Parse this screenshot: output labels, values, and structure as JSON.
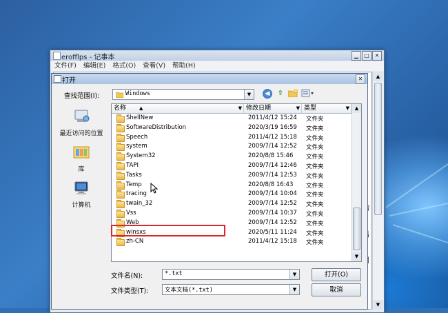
{
  "notepad": {
    "title": "erofflps - 记事本",
    "menu": [
      "文件(F)",
      "编辑(E)",
      "格式(O)",
      "查看(V)",
      "帮助(H)"
    ],
    "side_chars": [
      "物",
      "出",
      "用"
    ]
  },
  "dialog": {
    "title": "打开",
    "look_in_label": "查找范围(I):",
    "look_in_value": "Windows",
    "places": [
      {
        "label": "最近访问的位置",
        "icon": "recent-places-icon"
      },
      {
        "label": "库",
        "icon": "libraries-icon"
      },
      {
        "label": "计算机",
        "icon": "computer-icon"
      }
    ],
    "columns": {
      "name": "名称",
      "date": "修改日期",
      "type": "类型"
    },
    "rows": [
      {
        "name": "ShellNew",
        "date": "2011/4/12 15:24",
        "type": "文件夹"
      },
      {
        "name": "SoftwareDistribution",
        "date": "2020/3/19 16:59",
        "type": "文件夹"
      },
      {
        "name": "Speech",
        "date": "2011/4/12 15:18",
        "type": "文件夹"
      },
      {
        "name": "system",
        "date": "2009/7/14 12:52",
        "type": "文件夹"
      },
      {
        "name": "System32",
        "date": "2020/8/8 15:46",
        "type": "文件夹"
      },
      {
        "name": "TAPI",
        "date": "2009/7/14 12:46",
        "type": "文件夹"
      },
      {
        "name": "Tasks",
        "date": "2009/7/14 12:53",
        "type": "文件夹"
      },
      {
        "name": "Temp",
        "date": "2020/8/8 16:43",
        "type": "文件夹"
      },
      {
        "name": "tracing",
        "date": "2009/7/14 10:04",
        "type": "文件夹"
      },
      {
        "name": "twain_32",
        "date": "2009/7/14 12:52",
        "type": "文件夹"
      },
      {
        "name": "Vss",
        "date": "2009/7/14 10:37",
        "type": "文件夹"
      },
      {
        "name": "Web",
        "date": "2009/7/14 12:52",
        "type": "文件夹"
      },
      {
        "name": "winsxs",
        "date": "2020/5/11 11:24",
        "type": "文件夹"
      },
      {
        "name": "zh-CN",
        "date": "2011/4/12 15:18",
        "type": "文件夹"
      }
    ],
    "filename_label": "文件名(N):",
    "filename_value": "*.txt",
    "filetype_label": "文件类型(T):",
    "filetype_value": "文本文档(*.txt)",
    "open_button": "打开(O)",
    "cancel_button": "取消",
    "highlight_color": "#d9252b"
  }
}
